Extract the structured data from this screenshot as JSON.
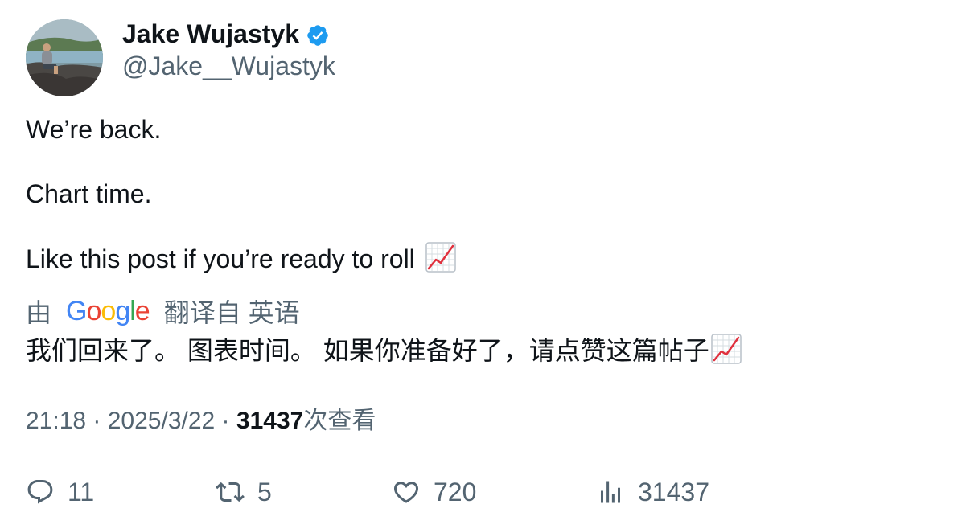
{
  "author": {
    "display_name": "Jake Wujastyk",
    "handle": "@Jake__Wujastyk",
    "verified_icon": "verified-badge-icon",
    "accent_color": "#1d9bf0"
  },
  "post": {
    "lines": [
      "We’re back.",
      "Chart time.",
      "Like this post if you’re ready to roll"
    ],
    "emoji": "chart-increasing-emoji"
  },
  "translation": {
    "prefix": "由",
    "logo_text": [
      "G",
      "o",
      "o",
      "g",
      "l",
      "e"
    ],
    "suffix": "翻译自 英语",
    "text": "我们回来了。 图表时间。 如果你准备好了，请点赞这篇帖子"
  },
  "meta": {
    "time": "21:18",
    "separator": " · ",
    "date": "2025/3/22",
    "views_count": "31437",
    "views_label": "次查看"
  },
  "actions": {
    "replies": "11",
    "reposts": "5",
    "likes": "720",
    "views": "31437"
  }
}
